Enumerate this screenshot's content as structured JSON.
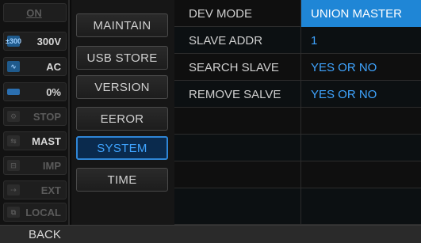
{
  "status": {
    "on": {
      "label": "ON"
    },
    "voltage": {
      "icon": "range-icon",
      "label": "300V",
      "icon_text": "±300"
    },
    "ac": {
      "icon": "wave-icon",
      "label": "AC",
      "icon_text": "∿"
    },
    "percent": {
      "icon": "bar-icon",
      "label": "0%"
    },
    "stop": {
      "icon": "gear-icon",
      "label": "STOP",
      "icon_text": "⚙"
    },
    "mast": {
      "icon": "master-icon",
      "label": "MAST",
      "icon_text": "⇆"
    },
    "imp": {
      "icon": "impedance-icon",
      "label": "IMP",
      "icon_text": "⊟"
    },
    "ext": {
      "icon": "external-icon",
      "label": "EXT",
      "icon_text": "⇢"
    },
    "local": {
      "icon": "local-icon",
      "label": "LOCAL",
      "icon_text": "⧉"
    }
  },
  "menu": {
    "items": [
      {
        "label": "MAINTAIN"
      },
      {
        "label": "USB STORE"
      },
      {
        "label": "VERSION"
      },
      {
        "label": "EEROR"
      },
      {
        "label": "SYSTEM"
      },
      {
        "label": "TIME"
      }
    ],
    "active_index": 4
  },
  "settings": {
    "rows": [
      {
        "label": "DEV MODE",
        "value": "UNION MASTER"
      },
      {
        "label": "SLAVE ADDR",
        "value": "1"
      },
      {
        "label": "SEARCH SLAVE",
        "value": "YES OR NO"
      },
      {
        "label": "REMOVE SALVE",
        "value": "YES OR NO"
      },
      {
        "label": "",
        "value": ""
      },
      {
        "label": "",
        "value": ""
      },
      {
        "label": "",
        "value": ""
      },
      {
        "label": "",
        "value": ""
      }
    ]
  },
  "footer": {
    "back_label": "BACK"
  },
  "colors": {
    "accent": "#3fa4ff",
    "selected_bg": "#1f86d6",
    "active_border": "#2f86d6"
  }
}
